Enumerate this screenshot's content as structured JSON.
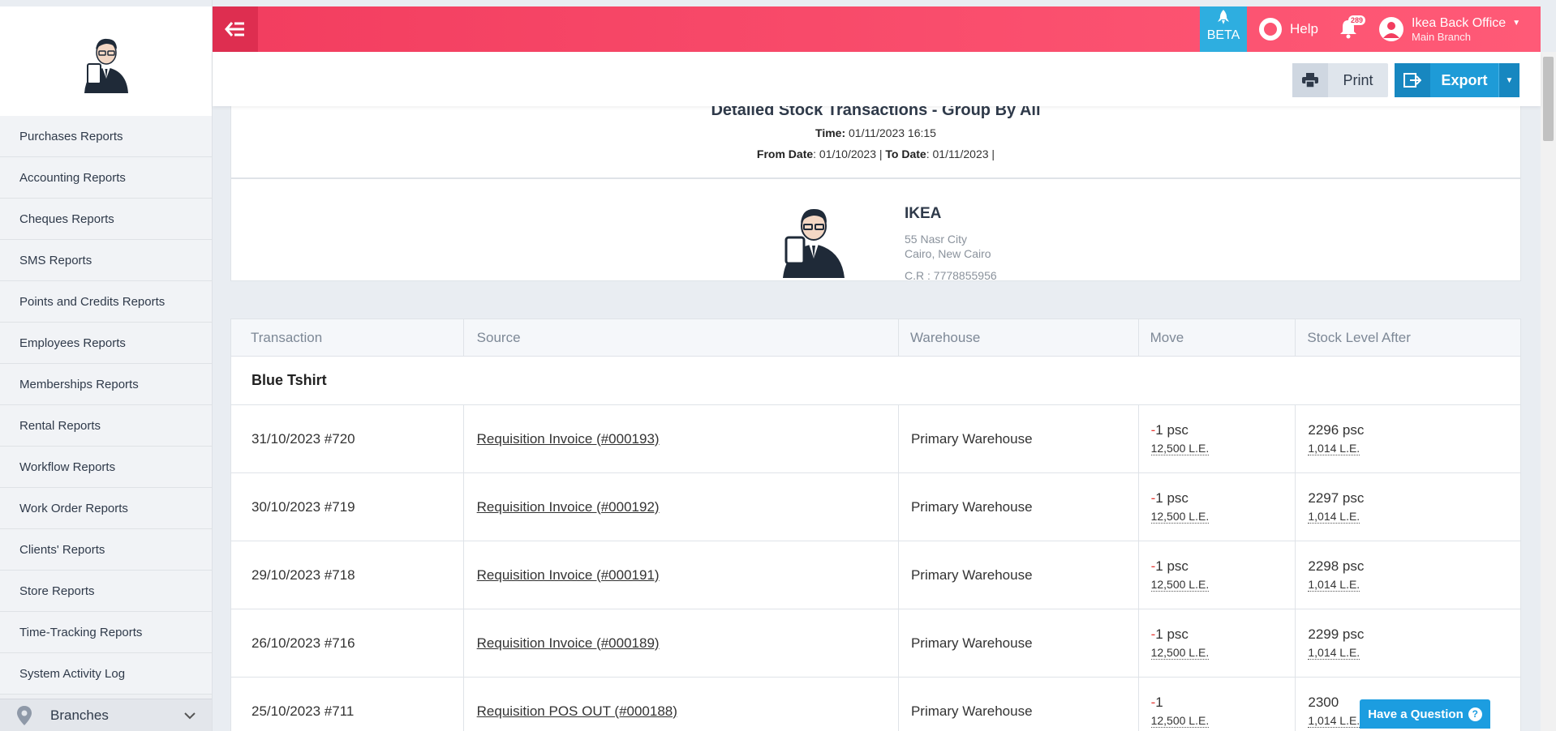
{
  "sidebar": {
    "items": [
      {
        "label": "Purchases Reports"
      },
      {
        "label": "Accounting Reports"
      },
      {
        "label": "Cheques Reports"
      },
      {
        "label": "SMS Reports"
      },
      {
        "label": "Points and Credits Reports"
      },
      {
        "label": "Employees Reports"
      },
      {
        "label": "Memberships Reports"
      },
      {
        "label": "Rental Reports"
      },
      {
        "label": "Workflow Reports"
      },
      {
        "label": "Work Order Reports"
      },
      {
        "label": "Clients' Reports"
      },
      {
        "label": "Store Reports"
      },
      {
        "label": "Time-Tracking Reports"
      },
      {
        "label": "System Activity Log"
      }
    ],
    "branches_label": "Branches"
  },
  "topbar": {
    "beta_label": "BETA",
    "help_label": "Help",
    "notifications_count": "289",
    "user_name": "Ikea Back Office",
    "user_branch": "Main Branch",
    "accent_color": "#f23d5f"
  },
  "actions": {
    "print_label": "Print",
    "export_label": "Export"
  },
  "report": {
    "title": "Detailed Stock Transactions - Group By All",
    "time_label": "Time:",
    "time_value": "01/11/2023 16:15",
    "from_label": "From Date",
    "from_value": ": 01/10/2023 |",
    "to_label": "To Date",
    "to_value": ": 01/11/2023 |"
  },
  "company": {
    "name": "IKEA",
    "address_line1": "55 Nasr City",
    "address_line2": "Cairo, New Cairo",
    "cr": "C.R : 7778855956"
  },
  "table": {
    "headers": {
      "transaction": "Transaction",
      "source": "Source",
      "warehouse": "Warehouse",
      "move": "Move",
      "stock_level": "Stock Level After"
    },
    "group_name": "Blue Tshirt",
    "rows": [
      {
        "transaction": "31/10/2023 #720",
        "source": "Requisition Invoice (#000193)",
        "warehouse": "Primary Warehouse",
        "move_sign": "-",
        "move_qty": "1 psc",
        "move_value": "12,500 L.E.",
        "level_qty": "2296 psc",
        "level_value": "1,014 L.E."
      },
      {
        "transaction": "30/10/2023 #719",
        "source": "Requisition Invoice (#000192)",
        "warehouse": "Primary Warehouse",
        "move_sign": "-",
        "move_qty": "1 psc",
        "move_value": "12,500 L.E.",
        "level_qty": "2297 psc",
        "level_value": "1,014 L.E."
      },
      {
        "transaction": "29/10/2023 #718",
        "source": "Requisition Invoice (#000191)",
        "warehouse": "Primary Warehouse",
        "move_sign": "-",
        "move_qty": "1 psc",
        "move_value": "12,500 L.E.",
        "level_qty": "2298 psc",
        "level_value": "1,014 L.E."
      },
      {
        "transaction": "26/10/2023 #716",
        "source": "Requisition Invoice (#000189)",
        "warehouse": "Primary Warehouse",
        "move_sign": "-",
        "move_qty": "1 psc",
        "move_value": "12,500 L.E.",
        "level_qty": "2299 psc",
        "level_value": "1,014 L.E."
      },
      {
        "transaction": "25/10/2023 #711",
        "source": "Requisition POS OUT (#000188)",
        "warehouse": "Primary Warehouse",
        "move_sign": "-",
        "move_qty": "1",
        "move_value": "12,500 L.E.",
        "level_qty": "2300",
        "level_value": "1,014 L.E."
      }
    ]
  },
  "question_label": "Have a Question",
  "question_icon": "?"
}
